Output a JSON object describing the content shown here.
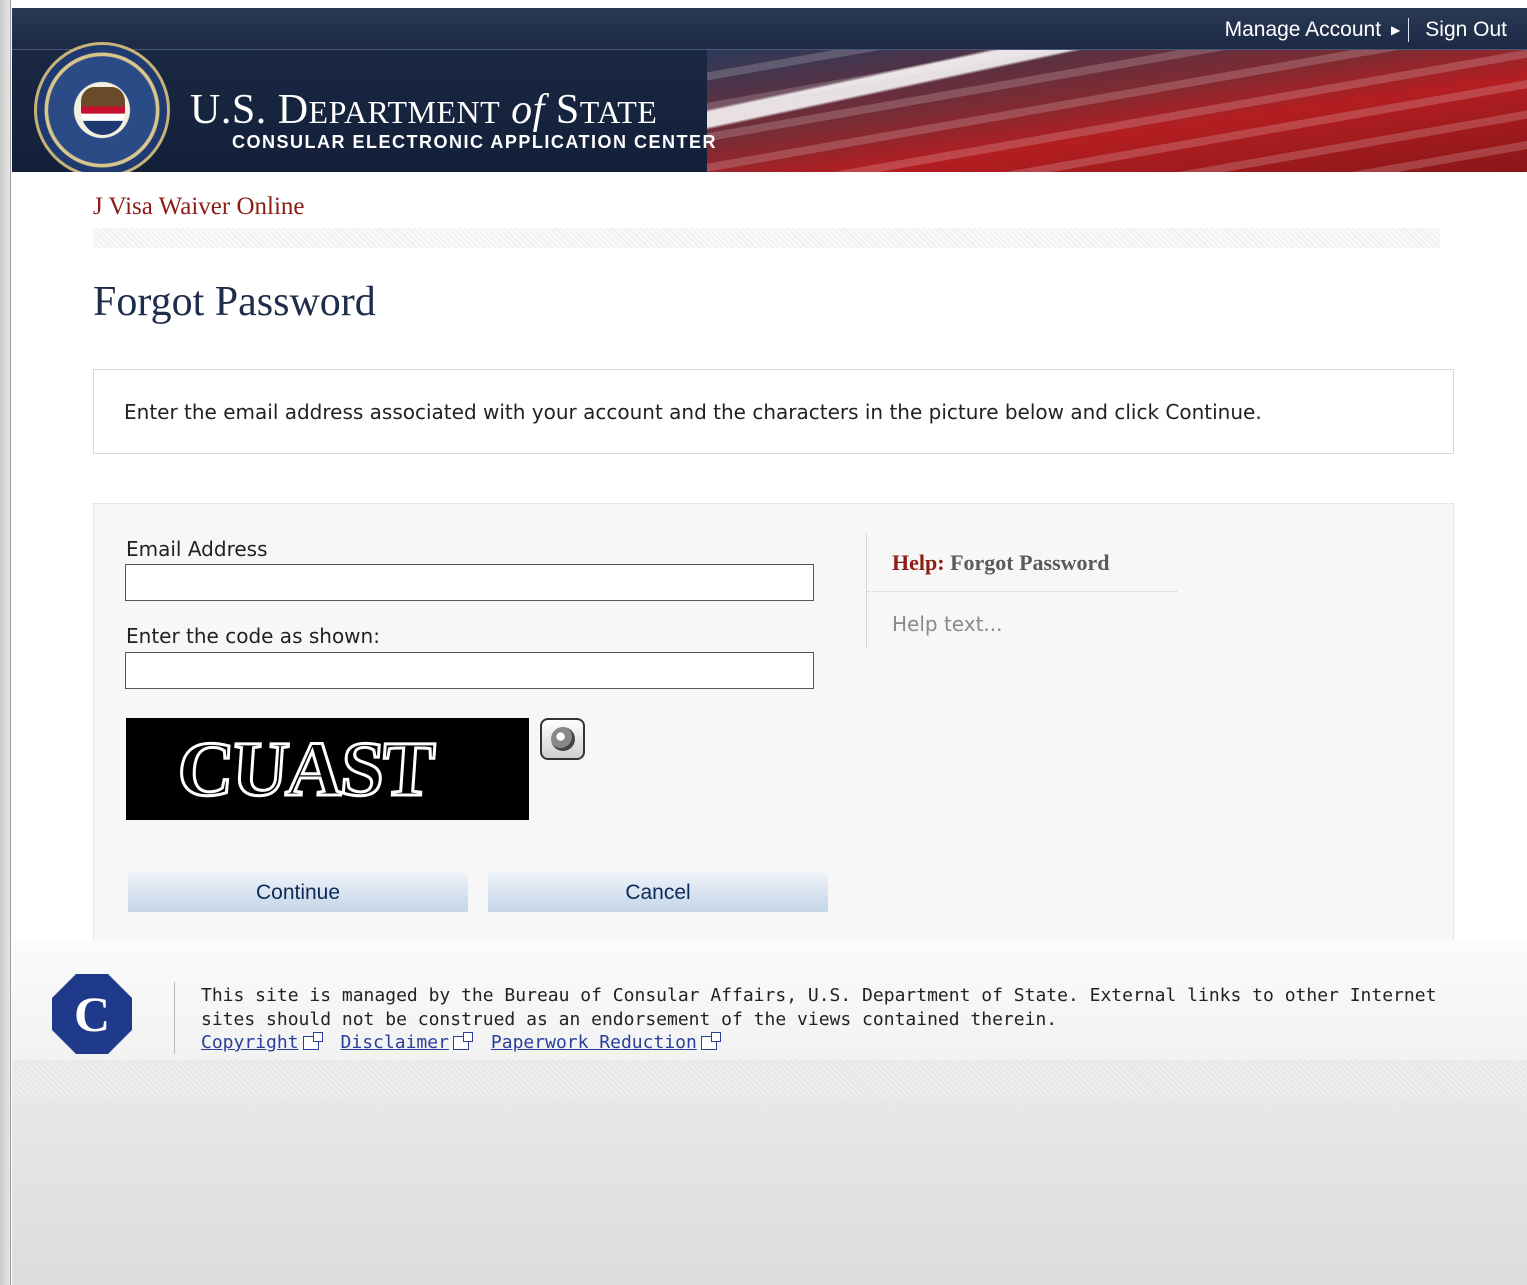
{
  "header": {
    "title_us": "U.S. D",
    "title_epartment": "EPARTMENT",
    "title_of": "of",
    "title_s": "S",
    "title_tate": "TATE",
    "subtitle": "CONSULAR ELECTRONIC APPLICATION CENTER",
    "nav": {
      "manage_account": "Manage Account",
      "sign_out": "Sign Out"
    }
  },
  "app_name": "J Visa Waiver Online",
  "page_title": "Forgot Password",
  "instructions": "Enter the email address associated with your account and the characters in the picture below and click Continue.",
  "form": {
    "email_label": "Email Address",
    "email_value": "",
    "code_label": "Enter the code as shown:",
    "code_value": "",
    "captcha_text": "CUAST",
    "continue_label": "Continue",
    "cancel_label": "Cancel"
  },
  "help": {
    "title_prefix": "Help:",
    "title_topic": "Forgot Password",
    "text": "Help text..."
  },
  "footer": {
    "text": "This site is managed by the Bureau of Consular Affairs, U.S. Department of State. External links to other Internet sites should not be construed as an endorsement of the views contained therein.",
    "links": [
      "Copyright",
      "Disclaimer",
      "Paperwork Reduction"
    ],
    "logo_letter": "C"
  },
  "colors": {
    "header_navy": "#1b2a45",
    "flag_red": "#b31e22",
    "app_name_red": "#8a1d14",
    "title_navy": "#1f2d4d",
    "button_blue": "#d6e2ef",
    "link_blue": "#2a3f9a"
  }
}
